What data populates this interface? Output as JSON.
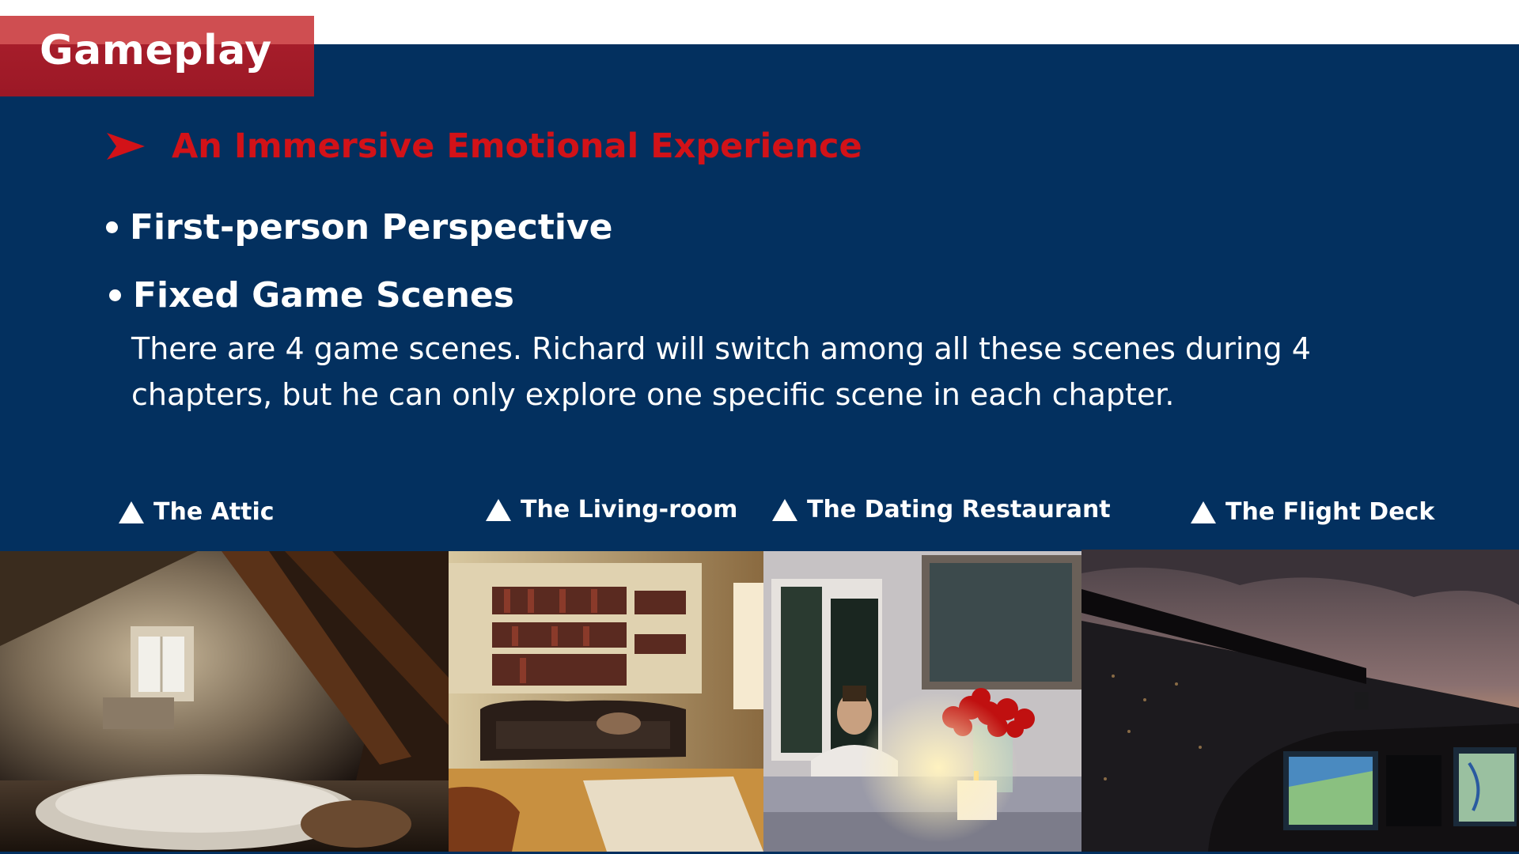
{
  "slide": {
    "title": "Gameplay",
    "subheading": "An Immersive Emotional Experience",
    "bullets": [
      {
        "label": "First-person Perspective"
      },
      {
        "label": "Fixed Game Scenes"
      }
    ],
    "description": "There are 4 game scenes. Richard will switch among all these scenes during 4 chapters, but he can only explore one specific scene in each chapter."
  },
  "scenes": [
    {
      "caption": "The Attic",
      "icon": "triangle-up-icon"
    },
    {
      "caption": "The Living-room",
      "icon": "triangle-up-icon"
    },
    {
      "caption": "The Dating Restaurant",
      "icon": "triangle-up-icon"
    },
    {
      "caption": "The Flight Deck",
      "icon": "triangle-up-icon"
    }
  ],
  "colors": {
    "background": "#03305f",
    "title_tab": "#a61d2a",
    "title_tab_highlight": "#cf4e51",
    "subheading": "#d21218",
    "text": "#ffffff"
  }
}
